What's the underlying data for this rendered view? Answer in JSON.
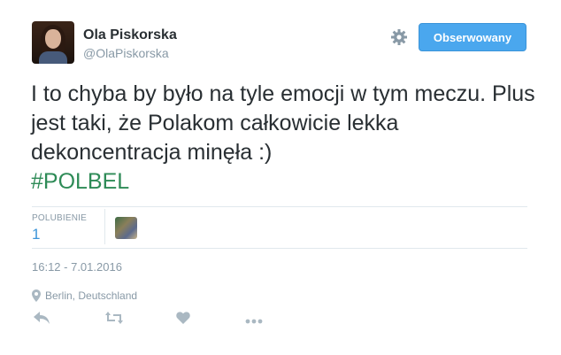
{
  "user": {
    "name": "Ola Piskorska",
    "handle": "@OlaPiskorska"
  },
  "follow_button": {
    "label": "Obserwowany"
  },
  "tweet": {
    "text": "I to chyba by było na tyle emocji w tym meczu. Plus jest taki, że Polakom całkowicie lekka dekoncentracja minęła :)",
    "hashtag": "#POLBEL"
  },
  "stats": {
    "likes_label": "POLUBIENIE",
    "likes_count": "1"
  },
  "timestamp": "16:12 - 7.01.2016",
  "location": "Berlin, Deutschland",
  "icons": {
    "settings": "gear-icon",
    "reply": "reply-icon",
    "retweet": "retweet-icon",
    "like": "heart-icon",
    "more": "more-icon",
    "location": "location-pin-icon"
  },
  "colors": {
    "follow_button": "#4aa7ee",
    "hashtag": "#2e8b57",
    "likes_count": "#3b94d9",
    "muted": "#8899a6"
  }
}
